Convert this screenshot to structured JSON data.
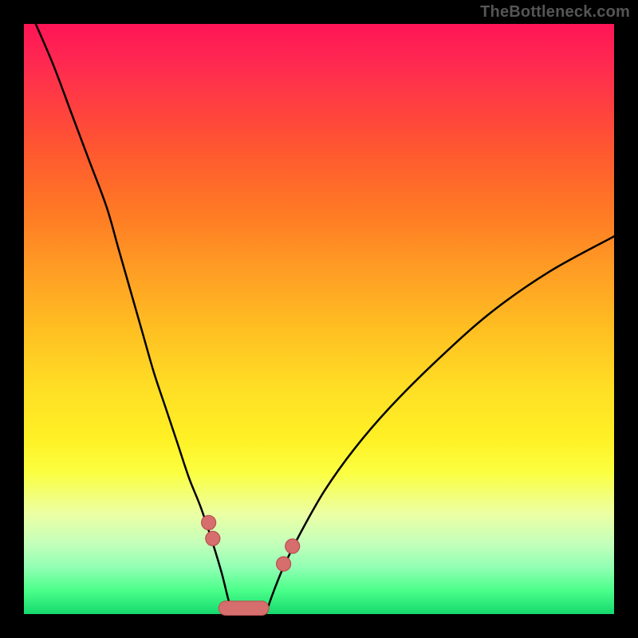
{
  "watermark": "TheBottleneck.com",
  "colors": {
    "frame": "#000000",
    "gradient_top": "#ff1556",
    "gradient_mid": "#ffdf25",
    "gradient_bottom": "#15d96d",
    "curve": "#000000",
    "marker_fill": "#d66e6e",
    "marker_stroke": "#b94f4f"
  },
  "chart_data": {
    "type": "line",
    "title": "",
    "xlabel": "",
    "ylabel": "",
    "xlim": [
      0,
      100
    ],
    "ylim": [
      0,
      100
    ],
    "grid": false,
    "legend": false,
    "series": [
      {
        "name": "left-branch",
        "x": [
          2,
          5,
          8,
          11,
          14,
          16,
          18,
          20,
          22,
          24,
          26,
          28,
          30,
          32,
          33.5,
          34.5,
          35.3
        ],
        "values": [
          100,
          93,
          85,
          77,
          69,
          62,
          55,
          48,
          41,
          35,
          29,
          23,
          18,
          12,
          7,
          3,
          0
        ]
      },
      {
        "name": "right-branch",
        "x": [
          41,
          42,
          44,
          47,
          51,
          56,
          62,
          70,
          79,
          89,
          100
        ],
        "values": [
          0,
          3,
          8,
          14,
          21,
          28,
          35,
          43,
          51,
          58,
          64
        ]
      }
    ],
    "markers": [
      {
        "x": 31.3,
        "y": 15.5
      },
      {
        "x": 32.0,
        "y": 12.8
      },
      {
        "x": 44.0,
        "y": 8.5
      },
      {
        "x": 45.5,
        "y": 11.5
      }
    ],
    "valley_bar": {
      "x_start": 33.0,
      "x_end": 41.5,
      "y": 1.0,
      "height": 2.4
    }
  }
}
